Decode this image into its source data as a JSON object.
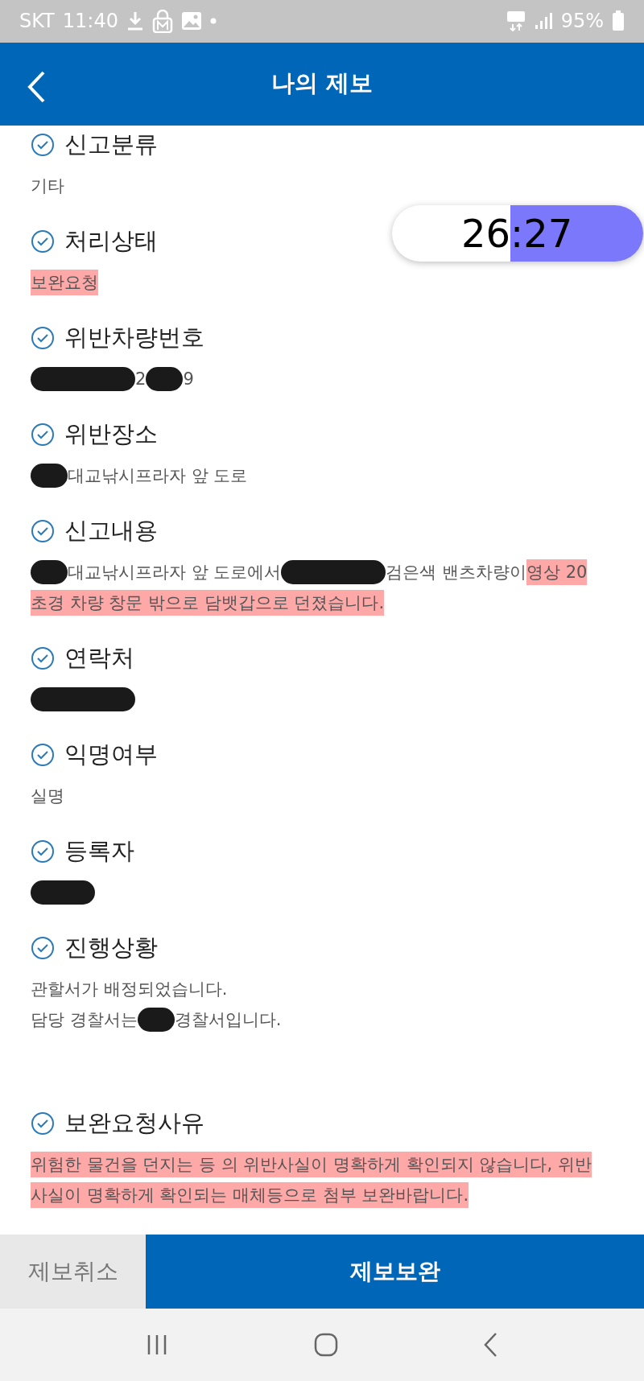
{
  "status_bar": {
    "carrier": "SKT",
    "time": "11:40",
    "battery": "95%"
  },
  "header": {
    "title": "나의 제보"
  },
  "timer": {
    "minutes": "26",
    "separator": ":",
    "seconds": "27"
  },
  "fields": [
    {
      "label": "신고분류",
      "lines": [
        [
          {
            "kind": "text",
            "text": "기타",
            "highlighted": false
          }
        ]
      ]
    },
    {
      "label": "처리상태",
      "lines": [
        [
          {
            "kind": "text",
            "text": "보완요청",
            "highlighted": true
          }
        ]
      ]
    },
    {
      "label": "위반차량번호",
      "lines": [
        [
          {
            "kind": "redacted_long"
          },
          {
            "kind": "text",
            "text": "2",
            "highlighted": false
          },
          {
            "kind": "redacted_short"
          },
          {
            "kind": "text",
            "text": "9",
            "highlighted": false
          }
        ]
      ]
    },
    {
      "label": "위반장소",
      "lines": [
        [
          {
            "kind": "redacted_short"
          },
          {
            "kind": "text",
            "text": "대교낚시프라자 앞 도로",
            "highlighted": false
          }
        ]
      ]
    },
    {
      "label": "신고내용",
      "lines": [
        [
          {
            "kind": "redacted_short"
          },
          {
            "kind": "text",
            "text": "대교낚시프라자 앞 도로에서",
            "highlighted": false
          },
          {
            "kind": "redacted_long"
          },
          {
            "kind": "text",
            "text": "검은색 밴츠차량이 ",
            "highlighted": false
          },
          {
            "kind": "text",
            "text": "영상 20",
            "highlighted": true
          }
        ],
        [
          {
            "kind": "text",
            "text": "초경 차량 창문 밖으로 담뱃갑으로 던졌습니다.",
            "highlighted": true
          }
        ]
      ]
    },
    {
      "label": "연락처",
      "lines": [
        [
          {
            "kind": "redacted_long"
          }
        ]
      ]
    },
    {
      "label": "익명여부",
      "lines": [
        [
          {
            "kind": "text",
            "text": "실명",
            "highlighted": false
          }
        ]
      ]
    },
    {
      "label": "등록자",
      "lines": [
        [
          {
            "kind": "redacted_medium"
          }
        ]
      ]
    },
    {
      "label": "진행상황",
      "lines": [
        [
          {
            "kind": "text",
            "text": "관할서가 배정되었습니다.",
            "highlighted": false
          }
        ],
        [
          {
            "kind": "text",
            "text": "담당 경찰서는",
            "highlighted": false
          },
          {
            "kind": "redacted_short"
          },
          {
            "kind": "text",
            "text": "경찰서입니다.",
            "highlighted": false
          }
        ]
      ]
    },
    {
      "label": "보완요청사유",
      "lines": [
        [
          {
            "kind": "text",
            "text": "위험한 물건을 던지는 등 의 위반사실이 명확하게 확인되지 않습니다, 위반",
            "highlighted": true
          }
        ],
        [
          {
            "kind": "text",
            "text": "사실이 명확하게 확인되는 매체등으로 첨부 보완바랍니다.",
            "highlighted": true
          }
        ]
      ]
    }
  ],
  "actions": [
    {
      "label": "제보취소",
      "kind": "secondary"
    },
    {
      "label": "제보보완",
      "kind": "primary"
    }
  ]
}
